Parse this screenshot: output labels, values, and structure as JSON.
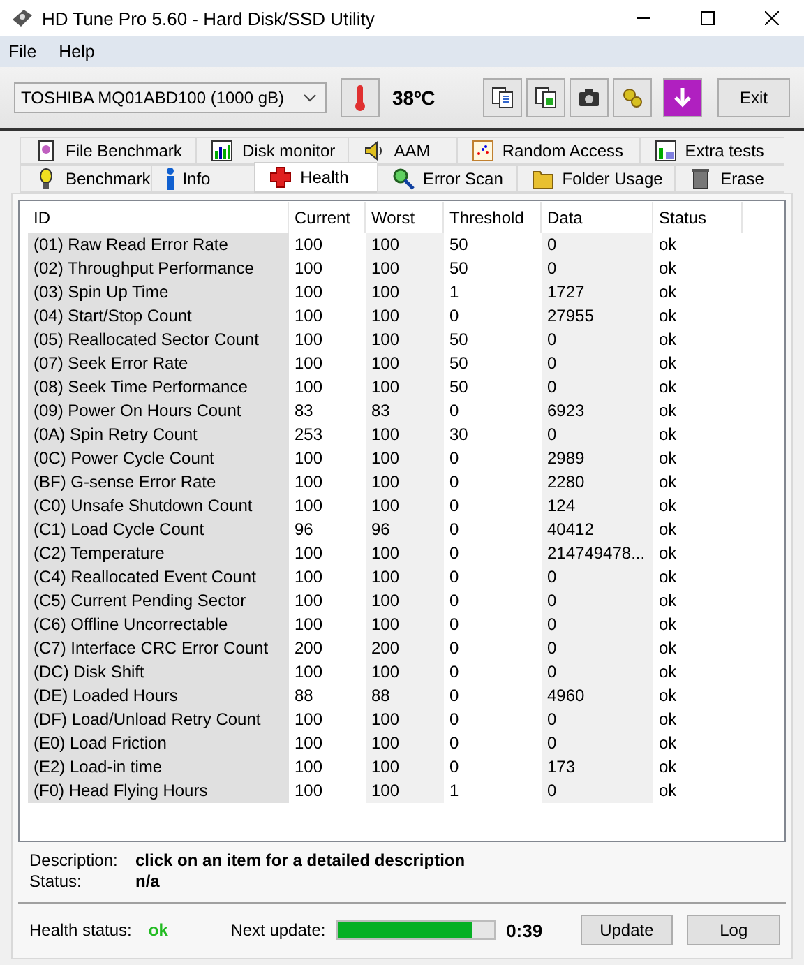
{
  "window": {
    "title": "HD Tune Pro 5.60 - Hard Disk/SSD Utility"
  },
  "menu": [
    "File",
    "Help"
  ],
  "toolbar": {
    "drive": "TOSHIBA MQ01ABD100 (1000 gB)",
    "temperature": "38ºC",
    "exit": "Exit"
  },
  "tab_rows": [
    [
      {
        "label": "File Benchmark",
        "kind": "file",
        "selected": false
      },
      {
        "label": "Disk monitor",
        "kind": "monitor",
        "selected": false
      },
      {
        "label": "AAM",
        "kind": "speaker",
        "selected": false
      },
      {
        "label": "Random Access",
        "kind": "scatter",
        "selected": false
      },
      {
        "label": "Extra tests",
        "kind": "extra",
        "selected": false
      }
    ],
    [
      {
        "label": "Benchmark",
        "kind": "bulb",
        "selected": false
      },
      {
        "label": "Info",
        "kind": "info",
        "selected": false
      },
      {
        "label": "Health",
        "kind": "cross",
        "selected": true
      },
      {
        "label": "Error Scan",
        "kind": "magnifier",
        "selected": false
      },
      {
        "label": "Folder Usage",
        "kind": "folder",
        "selected": false
      },
      {
        "label": "Erase",
        "kind": "trash",
        "selected": false
      }
    ]
  ],
  "table": {
    "columns": [
      "ID",
      "Current",
      "Worst",
      "Threshold",
      "Data",
      "Status"
    ],
    "rows": [
      [
        "(01) Raw Read Error Rate",
        "100",
        "100",
        "50",
        "0",
        "ok"
      ],
      [
        "(02) Throughput Performance",
        "100",
        "100",
        "50",
        "0",
        "ok"
      ],
      [
        "(03) Spin Up Time",
        "100",
        "100",
        "1",
        "1727",
        "ok"
      ],
      [
        "(04) Start/Stop Count",
        "100",
        "100",
        "0",
        "27955",
        "ok"
      ],
      [
        "(05) Reallocated Sector Count",
        "100",
        "100",
        "50",
        "0",
        "ok"
      ],
      [
        "(07) Seek Error Rate",
        "100",
        "100",
        "50",
        "0",
        "ok"
      ],
      [
        "(08) Seek Time Performance",
        "100",
        "100",
        "50",
        "0",
        "ok"
      ],
      [
        "(09) Power On Hours Count",
        "83",
        "83",
        "0",
        "6923",
        "ok"
      ],
      [
        "(0A) Spin Retry Count",
        "253",
        "100",
        "30",
        "0",
        "ok"
      ],
      [
        "(0C) Power Cycle Count",
        "100",
        "100",
        "0",
        "2989",
        "ok"
      ],
      [
        "(BF) G-sense Error Rate",
        "100",
        "100",
        "0",
        "2280",
        "ok"
      ],
      [
        "(C0) Unsafe Shutdown Count",
        "100",
        "100",
        "0",
        "124",
        "ok"
      ],
      [
        "(C1) Load Cycle Count",
        "96",
        "96",
        "0",
        "40412",
        "ok"
      ],
      [
        "(C2) Temperature",
        "100",
        "100",
        "0",
        "214749478...",
        "ok"
      ],
      [
        "(C4) Reallocated Event Count",
        "100",
        "100",
        "0",
        "0",
        "ok"
      ],
      [
        "(C5) Current Pending Sector",
        "100",
        "100",
        "0",
        "0",
        "ok"
      ],
      [
        "(C6) Offline Uncorrectable",
        "100",
        "100",
        "0",
        "0",
        "ok"
      ],
      [
        "(C7) Interface CRC Error Count",
        "200",
        "200",
        "0",
        "0",
        "ok"
      ],
      [
        "(DC) Disk Shift",
        "100",
        "100",
        "0",
        "0",
        "ok"
      ],
      [
        "(DE) Loaded Hours",
        "88",
        "88",
        "0",
        "4960",
        "ok"
      ],
      [
        "(DF) Load/Unload Retry Count",
        "100",
        "100",
        "0",
        "0",
        "ok"
      ],
      [
        "(E0) Load Friction",
        "100",
        "100",
        "0",
        "0",
        "ok"
      ],
      [
        "(E2) Load-in time",
        "100",
        "100",
        "0",
        "173",
        "ok"
      ],
      [
        "(F0) Head Flying Hours",
        "100",
        "100",
        "1",
        "0",
        "ok"
      ]
    ]
  },
  "details": {
    "description_label": "Description:",
    "description": "click on an item for a detailed description",
    "status_label": "Status:",
    "status": "n/a"
  },
  "footer": {
    "health_label": "Health status:",
    "health": "ok",
    "next_update_label": "Next update:",
    "level": 0.86,
    "countdown": "0:39",
    "buttons": [
      "Update",
      "Log"
    ]
  }
}
